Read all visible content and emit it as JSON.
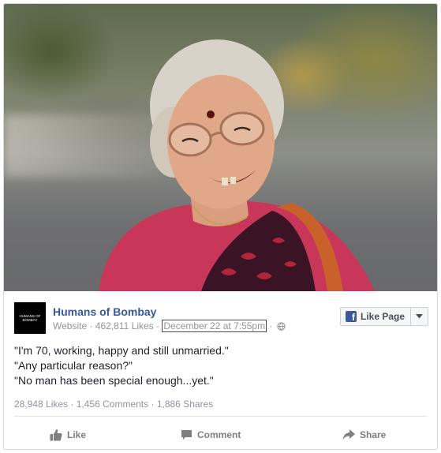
{
  "post": {
    "page_name": "Humans of Bombay",
    "avatar_text": "HUMANS OF BOMBAY",
    "category": "Website",
    "likes": "462,811 Likes",
    "separator": "·",
    "date": "December 22 at 7:55pm",
    "text_lines": [
      "\"I'm 70, working, happy and still unmarried.\"",
      "\"Any particular reason?\"",
      "\"No man has been special enough...yet.\""
    ]
  },
  "like_page_button": {
    "label": "Like Page"
  },
  "stats": {
    "likes": "28,948 Likes",
    "comments": "1,456 Comments",
    "shares": "1,886 Shares",
    "separator": "·"
  },
  "actions": {
    "like": "Like",
    "comment": "Comment",
    "share": "Share"
  },
  "icons": {
    "globe": "globe-icon",
    "like": "thumbs-up-icon",
    "comment": "comment-icon",
    "share": "share-arrow-icon",
    "dropdown": "chevron-down-icon",
    "facebook": "facebook-logo-icon"
  },
  "colors": {
    "link_blue": "#365899",
    "facebook_blue": "#3b5998",
    "meta_gray": "#90949c",
    "text": "#1d2129"
  }
}
